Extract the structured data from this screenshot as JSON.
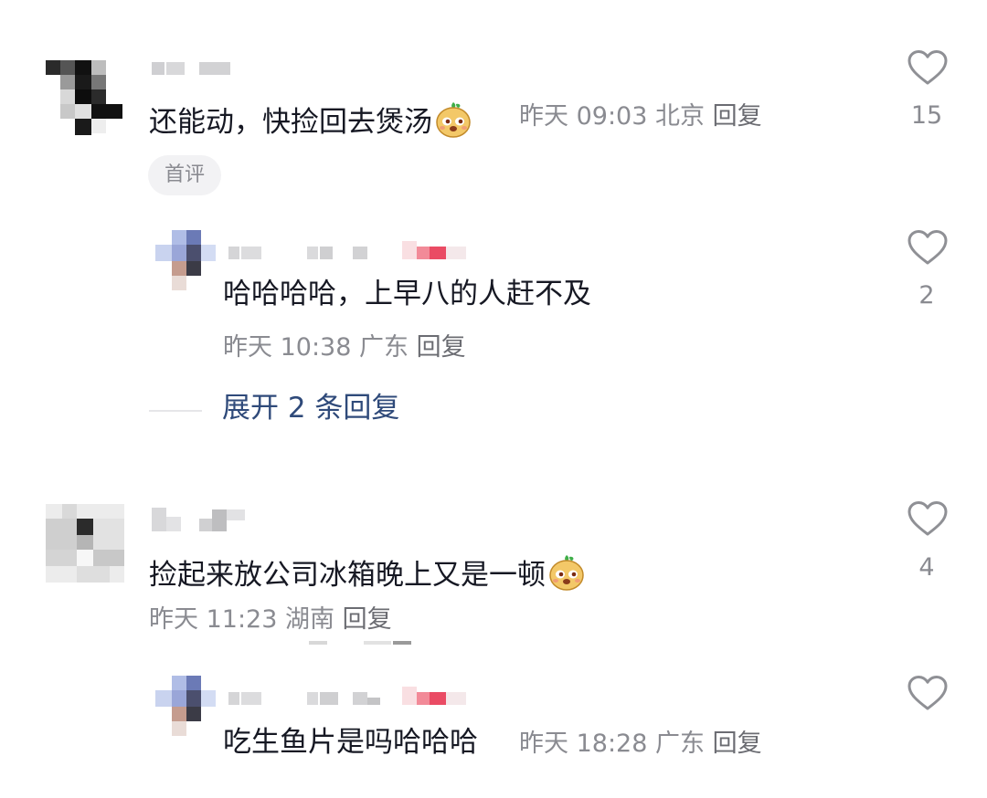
{
  "comments": [
    {
      "text": "还能动，快捡回去煲汤",
      "time": "昨天 09:03",
      "location": "北京",
      "reply": "回复",
      "likes": "15",
      "badge": "首评",
      "emoji": "doge-sweet-potato-emoji"
    },
    {
      "text": "哈哈哈哈，上早八的人赶不及",
      "time": "昨天 10:38",
      "location": "广东",
      "reply": "回复",
      "likes": "2"
    },
    {
      "text": "捡起来放公司冰箱晚上又是一顿",
      "time": "昨天 11:23",
      "location": "湖南",
      "reply": "回复",
      "likes": "4",
      "emoji": "doge-sweet-potato-emoji"
    },
    {
      "text": "吃生鱼片是吗哈哈哈",
      "time": "昨天 18:28",
      "location": "广东",
      "reply": "回复",
      "likes": ""
    }
  ],
  "expand_replies": "展开 2 条回复",
  "colors": {
    "text": "#161823",
    "meta": "#8a8b91",
    "link": "#2f4a7a",
    "badge_bg": "#f2f2f4"
  },
  "icons": [
    "heart-outline-icon",
    "doge-sweet-potato-emoji"
  ]
}
